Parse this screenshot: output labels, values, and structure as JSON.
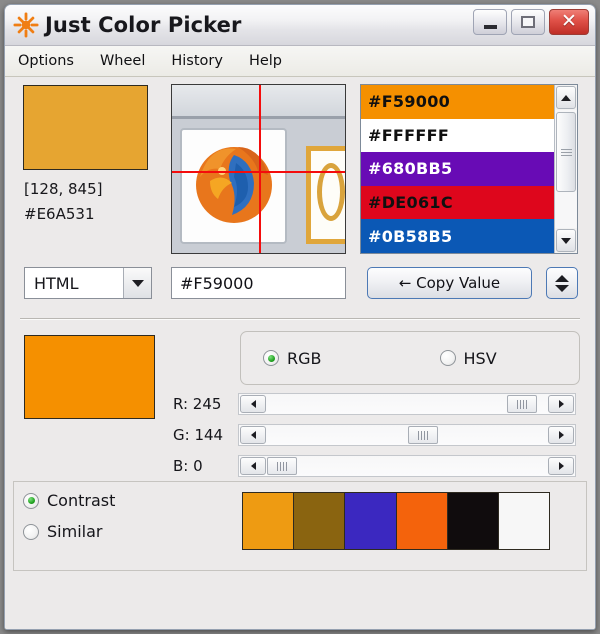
{
  "window": {
    "title": "Just Color Picker",
    "app_icon": "starburst-icon",
    "controls": {
      "minimize": "minimize",
      "maximize": "maximize",
      "close": "close"
    }
  },
  "menu": {
    "items": [
      {
        "label": "Options"
      },
      {
        "label": "Wheel"
      },
      {
        "label": "History"
      },
      {
        "label": "Help"
      }
    ]
  },
  "picked": {
    "preview_color": "#E6A531",
    "coordinates": "[128, 845]",
    "hex": "#E6A531"
  },
  "magnifier": {
    "crosshair_color": "#F40C0C"
  },
  "color_list": {
    "items": [
      {
        "hex": "#F59000",
        "bg": "#F59000",
        "fg": "#101010"
      },
      {
        "hex": "#FFFFFF",
        "bg": "#FFFFFF",
        "fg": "#101010"
      },
      {
        "hex": "#680BB5",
        "bg": "#680BB5",
        "fg": "#FFFFFF"
      },
      {
        "hex": "#DE061C",
        "bg": "#DE061C",
        "fg": "#101010"
      },
      {
        "hex": "#0B58B5",
        "bg": "#0B58B5",
        "fg": "#FFFFFF"
      }
    ],
    "scrollbar": {
      "up": "scroll-up",
      "down": "scroll-down"
    }
  },
  "format_row": {
    "format_selected": "HTML",
    "value": "#F59000",
    "copy_label": "← Copy Value",
    "spinner": "stepper"
  },
  "current": {
    "swatch_color": "#F59000",
    "mode_selected": "RGB",
    "modes": [
      {
        "label": "RGB",
        "selected": true
      },
      {
        "label": "HSV",
        "selected": false
      }
    ],
    "channels": [
      {
        "label": "R: 245",
        "name": "R",
        "value": 245,
        "max": 255
      },
      {
        "label": "G: 144",
        "name": "G",
        "value": 144,
        "max": 255
      },
      {
        "label": "B: 0",
        "name": "B",
        "value": 0,
        "max": 255
      }
    ]
  },
  "harmony": {
    "options": [
      {
        "label": "Contrast",
        "selected": true
      },
      {
        "label": "Similar",
        "selected": false
      }
    ],
    "swatches": [
      "#EE9B12",
      "#8A6410",
      "#3B28C0",
      "#F4630C",
      "#100C0D",
      "#F7F7F7"
    ]
  }
}
